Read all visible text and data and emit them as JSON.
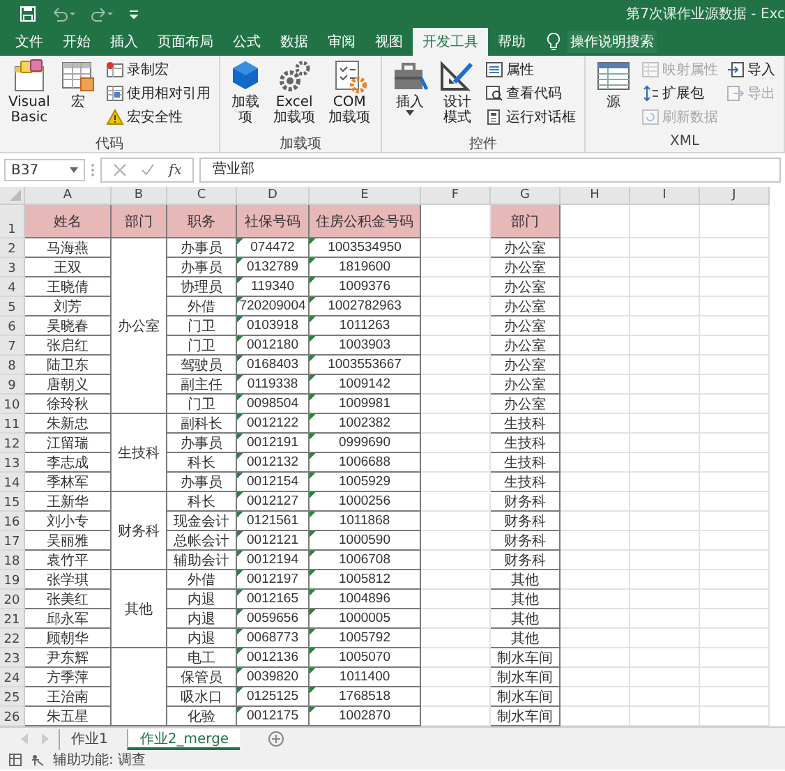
{
  "window": {
    "title": "第7次课作业源数据 - Exc"
  },
  "ribbon_tabs": [
    {
      "label": "文件",
      "selected": false
    },
    {
      "label": "开始",
      "selected": false
    },
    {
      "label": "插入",
      "selected": false
    },
    {
      "label": "页面布局",
      "selected": false
    },
    {
      "label": "公式",
      "selected": false
    },
    {
      "label": "数据",
      "selected": false
    },
    {
      "label": "审阅",
      "selected": false
    },
    {
      "label": "视图",
      "selected": false
    },
    {
      "label": "开发工具",
      "selected": true
    },
    {
      "label": "帮助",
      "selected": false
    }
  ],
  "tell_me": "操作说明搜索",
  "ribbon_groups": [
    {
      "label": "代码",
      "buttons": [
        {
          "kind": "large",
          "label": "Visual Basic",
          "disabled": false,
          "dropdown": false
        },
        {
          "kind": "large",
          "label": "宏",
          "disabled": false,
          "dropdown": false
        },
        {
          "kind": "small",
          "label": "录制宏",
          "disabled": false
        },
        {
          "kind": "small",
          "label": "使用相对引用",
          "disabled": false
        },
        {
          "kind": "small",
          "label": "宏安全性",
          "disabled": false
        }
      ]
    },
    {
      "label": "加载项",
      "buttons": [
        {
          "kind": "large",
          "label": "加载项",
          "disabled": false,
          "dropdown": false
        },
        {
          "kind": "large",
          "label": "Excel 加载项",
          "disabled": false,
          "dropdown": false
        },
        {
          "kind": "large",
          "label": "COM 加载项",
          "disabled": false,
          "dropdown": false
        }
      ]
    },
    {
      "label": "控件",
      "buttons": [
        {
          "kind": "large",
          "label": "插入",
          "disabled": false,
          "dropdown": true
        },
        {
          "kind": "large",
          "label": "设计模式",
          "disabled": false,
          "dropdown": false
        },
        {
          "kind": "small",
          "label": "属性",
          "disabled": false
        },
        {
          "kind": "small",
          "label": "查看代码",
          "disabled": false
        },
        {
          "kind": "small",
          "label": "运行对话框",
          "disabled": false
        }
      ]
    },
    {
      "label": "XML",
      "buttons": [
        {
          "kind": "large",
          "label": "源",
          "disabled": false,
          "dropdown": false
        },
        {
          "kind": "small",
          "label": "映射属性",
          "disabled": true
        },
        {
          "kind": "small",
          "label": "扩展包",
          "disabled": false
        },
        {
          "kind": "small",
          "label": "刷新数据",
          "disabled": true
        },
        {
          "kind": "small",
          "label": "导入",
          "disabled": false
        },
        {
          "kind": "small",
          "label": "导出",
          "disabled": true
        }
      ]
    }
  ],
  "formula_bar": {
    "name_box": "B37",
    "function_label": "fx",
    "value": "营业部"
  },
  "sheet": {
    "columns": [
      "A",
      "B",
      "C",
      "D",
      "E",
      "F",
      "G",
      "H",
      "I",
      "J"
    ],
    "row_numbers": [
      "1",
      "2",
      "3",
      "4",
      "5",
      "6",
      "7",
      "8",
      "9",
      "10",
      "11",
      "12",
      "13",
      "14",
      "15",
      "16",
      "17",
      "18",
      "19",
      "20",
      "21",
      "22",
      "23",
      "24",
      "25",
      "26"
    ],
    "headers": [
      "姓名",
      "部门",
      "职务",
      "社保号码",
      "住房公积金号码"
    ],
    "g_header": "部门",
    "departments": [
      {
        "label": "办公室",
        "rows": [
          {
            "name": "马海燕",
            "role": "办事员",
            "social": "074472",
            "housing": "1003534950",
            "g": "办公室"
          },
          {
            "name": "王双",
            "role": "办事员",
            "social": "0132789",
            "housing": "1819600",
            "g": "办公室"
          },
          {
            "name": "王晓倩",
            "role": "协理员",
            "social": "119340",
            "housing": "1009376",
            "g": "办公室"
          },
          {
            "name": "刘芳",
            "role": "外借",
            "social": "720209004",
            "housing": "1002782963",
            "g": "办公室"
          },
          {
            "name": "吴晓春",
            "role": "门卫",
            "social": "0103918",
            "housing": "1011263",
            "g": "办公室"
          },
          {
            "name": "张启红",
            "role": "门卫",
            "social": "0012180",
            "housing": "1003903",
            "g": "办公室"
          },
          {
            "name": "陆卫东",
            "role": "驾驶员",
            "social": "0168403",
            "housing": "1003553667",
            "g": "办公室"
          },
          {
            "name": "唐朝义",
            "role": "副主任",
            "social": "0119338",
            "housing": "1009142",
            "g": "办公室"
          },
          {
            "name": "徐玲秋",
            "role": "门卫",
            "social": "0098504",
            "housing": "1009981",
            "g": "办公室"
          }
        ]
      },
      {
        "label": "生技科",
        "rows": [
          {
            "name": "朱新忠",
            "role": "副科长",
            "social": "0012122",
            "housing": "1002382",
            "g": "生技科"
          },
          {
            "name": "江留瑞",
            "role": "办事员",
            "social": "0012191",
            "housing": "0999690",
            "g": "生技科"
          },
          {
            "name": "李志成",
            "role": "科长",
            "social": "0012132",
            "housing": "1006688",
            "g": "生技科"
          },
          {
            "name": "季林军",
            "role": "办事员",
            "social": "0012154",
            "housing": "1005929",
            "g": "生技科"
          }
        ]
      },
      {
        "label": "财务科",
        "rows": [
          {
            "name": "王新华",
            "role": "科长",
            "social": "0012127",
            "housing": "1000256",
            "g": "财务科"
          },
          {
            "name": "刘小专",
            "role": "现金会计",
            "social": "0121561",
            "housing": "1011868",
            "g": "财务科"
          },
          {
            "name": "吴丽雅",
            "role": "总帐会计",
            "social": "0012121",
            "housing": "1000590",
            "g": "财务科"
          },
          {
            "name": "袁竹平",
            "role": "辅助会计",
            "social": "0012194",
            "housing": "1006708",
            "g": "财务科"
          }
        ]
      },
      {
        "label": "其他",
        "rows": [
          {
            "name": "张学琪",
            "role": "外借",
            "social": "0012197",
            "housing": "1005812",
            "g": "其他"
          },
          {
            "name": "张美红",
            "role": "内退",
            "social": "0012165",
            "housing": "1004896",
            "g": "其他"
          },
          {
            "name": "邱永军",
            "role": "内退",
            "social": "0059656",
            "housing": "1000005",
            "g": "其他"
          },
          {
            "name": "顾朝华",
            "role": "内退",
            "social": "0068773",
            "housing": "1005792",
            "g": "其他"
          }
        ]
      },
      {
        "rows": [
          {
            "name": "尹东辉",
            "role": "电工",
            "social": "0012136",
            "housing": "1005070",
            "g": "制水车间"
          },
          {
            "name": "方季萍",
            "role": "保管员",
            "social": "0039820",
            "housing": "1011400",
            "g": "制水车间"
          },
          {
            "name": "王治南",
            "role": "吸水口",
            "social": "0125125",
            "housing": "1768518",
            "g": "制水车间"
          },
          {
            "name": "朱五星",
            "role": "化验",
            "social": "0012175",
            "housing": "1002870",
            "g": "制水车间"
          }
        ]
      }
    ]
  },
  "sheet_tabs": [
    {
      "label": "作业1",
      "selected": false
    },
    {
      "label": "作业2_merge",
      "selected": true
    }
  ],
  "status_bar": {
    "accessibility": "辅助功能: 调查"
  }
}
